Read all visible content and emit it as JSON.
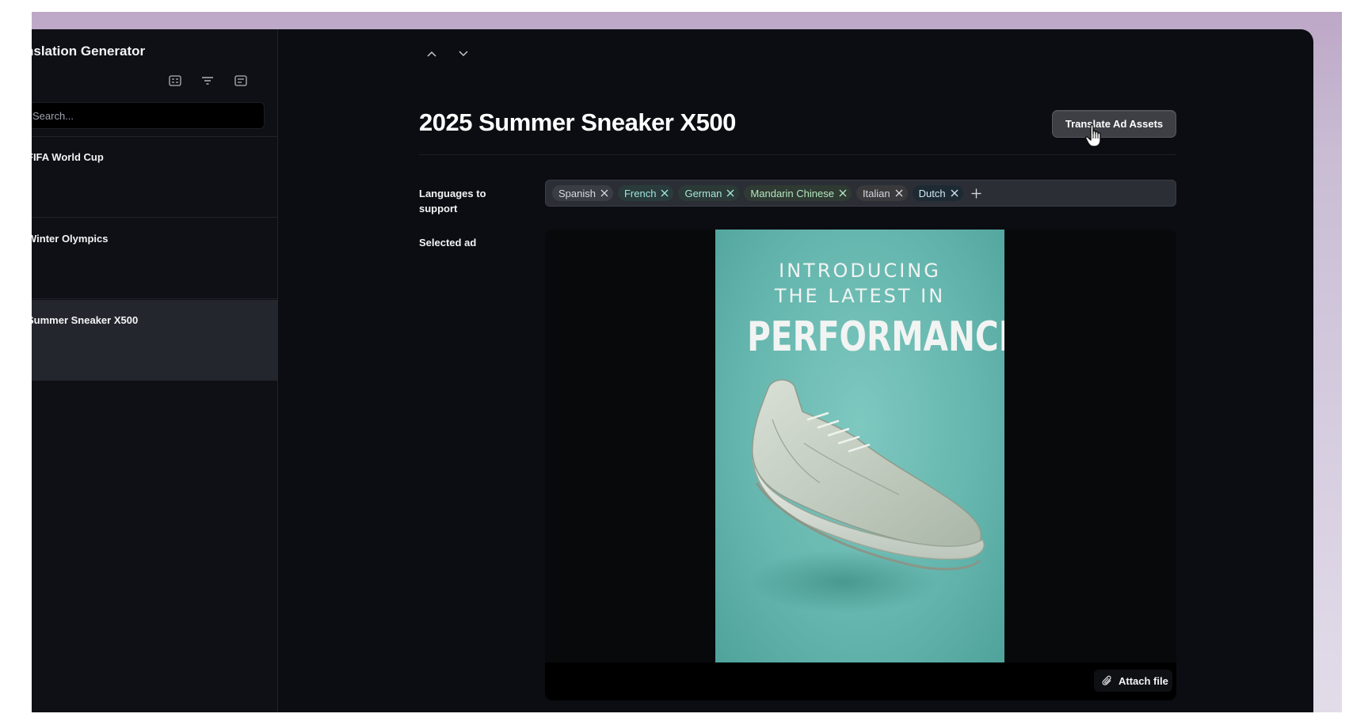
{
  "app": {
    "title": "nslation Generator"
  },
  "sidebar": {
    "search_placeholder": "Search...",
    "items": [
      {
        "label": "FIFA World Cup",
        "active": false
      },
      {
        "label": "Winter Olympics",
        "active": false
      },
      {
        "label": "Summer Sneaker X500",
        "active": true
      }
    ]
  },
  "main": {
    "title": "2025 Summer Sneaker X500",
    "translate_button": "Translate Ad Assets",
    "languages_label": "Languages to support",
    "selected_ad_label": "Selected ad",
    "languages": [
      {
        "name": "Spanish",
        "bg": "#3a3d44",
        "fg": "#d8dbe0"
      },
      {
        "name": "French",
        "bg": "#2a3b3b",
        "fg": "#9ee3dc"
      },
      {
        "name": "German",
        "bg": "#2c3a37",
        "fg": "#a5e6d6"
      },
      {
        "name": "Mandarin Chinese",
        "bg": "#2f3a33",
        "fg": "#b3e6bf"
      },
      {
        "name": "Italian",
        "bg": "#3a3a3d",
        "fg": "#d5d6d9"
      },
      {
        "name": "Dutch",
        "bg": "#1e2a33",
        "fg": "#cfe6f3"
      }
    ],
    "ad": {
      "line1": "INTRODUCING",
      "line2": "THE LATEST IN",
      "line3": "PERFORMANCE"
    },
    "attach_button": "Attach file"
  }
}
